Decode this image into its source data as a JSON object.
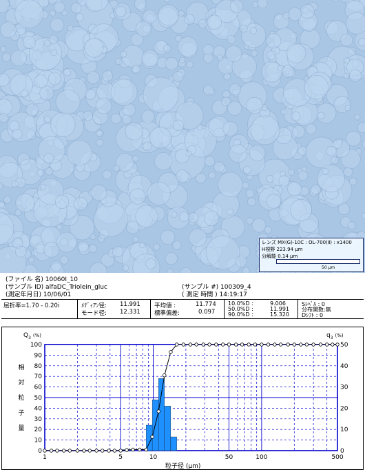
{
  "micrograph": {
    "lens_label": "レンズ",
    "lens_value": "MX(G)-10C : OL-700(Ⅱ) : x1400",
    "fov_label": "H視野",
    "fov_value": "223.94 μm",
    "resolution_label": "分解能",
    "resolution_value": "0.14 μm",
    "scale_label": "50 μm",
    "colors": {
      "background": "#a9c6e4",
      "droplet": "#bdd6ee",
      "edge": "#7f9fc6"
    }
  },
  "info": {
    "file_name": "(ファイル 名) 10060I_10",
    "sample_id": "(サンプル ID) alfaDC_Triolein_gluc",
    "sample_no": "(サンプル #) 100309_4",
    "measure_date": "(測定年月日) 10/06/01",
    "measure_time": "( 測定 時間 ) 14:19:17"
  },
  "stats": {
    "refractive_index": "屈折率=1.70 - 0.20i",
    "median_label": "ﾒﾃﾞｨｱﾝ径:",
    "median_value": "11.991",
    "mode_label": "モード径:",
    "mode_value": "12.331",
    "mean_label": "平均値  :",
    "mean_value": "11.774",
    "std_label": "標準偏差:",
    "std_value": "0.097",
    "d10_label": "10.0%D :",
    "d10_value": "9.006",
    "d50_label": "50.0%D :",
    "d50_value": "11.991",
    "d90_label": "90.0%D :",
    "d90_value": "15.320",
    "slevel": "Sﾚﾍﾞﾙ : 0",
    "distfunc": "分布関数:無",
    "dshift": "Dｼﾌﾄ  : 0"
  },
  "chart_labels": {
    "q3": "Q",
    "q3_sub": "3",
    "q3_unit": "(%)",
    "q3_right": "q",
    "q3_right_sub": "3",
    "q3_right_unit": "(%)",
    "ylabel_chars": [
      "相",
      "対",
      "粒",
      "子",
      "量"
    ],
    "xlabel": "粒子径 (μm)"
  },
  "chart_data": {
    "type": "bar",
    "xscale": "log",
    "xlim": [
      1,
      500
    ],
    "ylim_left": [
      0,
      100
    ],
    "ylim_right": [
      0,
      50
    ],
    "x_ticks": [
      1,
      5,
      10,
      50,
      100,
      500
    ],
    "y_left_ticks": [
      0,
      10,
      20,
      30,
      40,
      50,
      60,
      70,
      80,
      90,
      100
    ],
    "y_right_ticks": [
      0,
      10,
      20,
      30,
      40,
      50
    ],
    "series": [
      {
        "name": "q3",
        "bars": [
          {
            "lo": 5.0,
            "hi": 5.7,
            "value": 0.5
          },
          {
            "lo": 5.7,
            "hi": 6.5,
            "value": 0.5
          },
          {
            "lo": 8.6,
            "hi": 9.8,
            "value": 12
          },
          {
            "lo": 9.8,
            "hi": 11.2,
            "value": 24
          },
          {
            "lo": 11.2,
            "hi": 12.7,
            "value": 34
          },
          {
            "lo": 12.7,
            "hi": 14.5,
            "value": 21
          },
          {
            "lo": 14.5,
            "hi": 16.5,
            "value": 6.5
          }
        ],
        "axis": "right"
      },
      {
        "name": "Q3",
        "x": [
          1.0,
          1.15,
          1.3,
          1.5,
          1.7,
          2.0,
          2.3,
          2.6,
          3.0,
          3.4,
          3.9,
          4.4,
          5.0,
          5.7,
          6.5,
          7.5,
          8.6,
          9.8,
          11.2,
          12.7,
          14.5,
          16.5,
          19,
          22,
          25,
          29,
          33,
          38,
          44,
          50,
          58,
          66,
          76,
          87,
          100,
          115,
          132,
          150,
          175,
          200,
          230,
          260,
          300,
          350,
          400,
          450,
          500
        ],
        "y": [
          0,
          0,
          0,
          0,
          0,
          0,
          0,
          0,
          0,
          0,
          0,
          0,
          0,
          0.6,
          1,
          1,
          1,
          13,
          37,
          71,
          93,
          100,
          100,
          100,
          100,
          100,
          100,
          100,
          100,
          100,
          100,
          100,
          100,
          100,
          100,
          100,
          100,
          100,
          100,
          100,
          100,
          100,
          100,
          100,
          100,
          100,
          100
        ],
        "axis": "left"
      }
    ],
    "colors": {
      "bars": "#1e90ff",
      "frame": "#0000cc",
      "grid": "#0000cc"
    }
  }
}
